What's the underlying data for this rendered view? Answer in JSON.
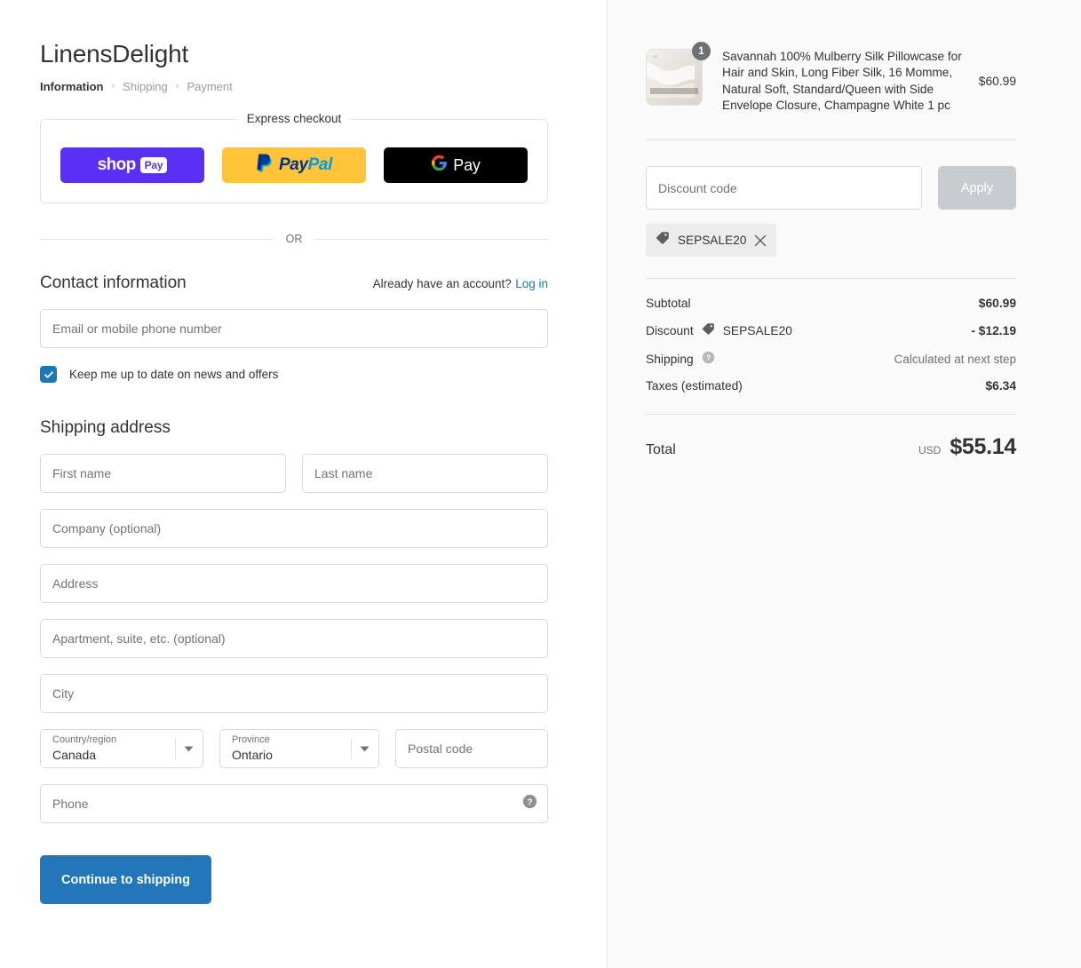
{
  "shop": {
    "name": "LinensDelight"
  },
  "breadcrumb": {
    "items": [
      {
        "label": "Information",
        "current": true
      },
      {
        "label": "Shipping",
        "current": false
      },
      {
        "label": "Payment",
        "current": false
      }
    ],
    "separator": "›"
  },
  "express": {
    "legend": "Express checkout",
    "buttons": [
      {
        "id": "shop-pay",
        "word": "shop",
        "badge": "Pay",
        "bg": "#5a31f4"
      },
      {
        "id": "paypal",
        "part1": "Pay",
        "part2": "Pal",
        "bg": "#ffc439"
      },
      {
        "id": "google-pay",
        "label": "Pay",
        "bg": "#000000"
      }
    ]
  },
  "divider": {
    "or": "OR"
  },
  "contact": {
    "title": "Contact information",
    "account_prompt": "Already have an account?",
    "login_link": "Log in",
    "email_placeholder": "Email or mobile phone number",
    "email_value": "",
    "newsletter_label": "Keep me up to date on news and offers",
    "newsletter_checked": true
  },
  "shipping_address": {
    "title": "Shipping address",
    "first_name_placeholder": "First name",
    "first_name_value": "",
    "last_name_placeholder": "Last name",
    "last_name_value": "",
    "company_placeholder": "Company (optional)",
    "company_value": "",
    "address_placeholder": "Address",
    "address_value": "",
    "apartment_placeholder": "Apartment, suite, etc. (optional)",
    "apartment_value": "",
    "city_placeholder": "City",
    "city_value": "",
    "country_label": "Country/region",
    "country_value": "Canada",
    "province_label": "Province",
    "province_value": "Ontario",
    "postal_placeholder": "Postal code",
    "postal_value": "",
    "phone_placeholder": "Phone",
    "phone_value": ""
  },
  "actions": {
    "continue_label": "Continue to shipping"
  },
  "order_summary": {
    "line_items": [
      {
        "title": "Savannah 100% Mulberry Silk Pillowcase for Hair and Skin, Long Fiber Silk, 16 Momme, Natural Soft, Standard/Queen with Side Envelope Closure, Champagne White 1 pc",
        "quantity": "1",
        "price": "$60.99"
      }
    ],
    "discount": {
      "placeholder": "Discount code",
      "value": "",
      "apply_label": "Apply",
      "applied_codes": [
        "SEPSALE20"
      ]
    },
    "totals": [
      {
        "label": "Subtotal",
        "value": "$60.99",
        "muted": false,
        "tag": "",
        "help": false
      },
      {
        "label": "Discount",
        "value": "- $12.19",
        "muted": false,
        "tag": "SEPSALE20",
        "help": false
      },
      {
        "label": "Shipping",
        "value": "Calculated at next step",
        "muted": true,
        "tag": "",
        "help": true
      },
      {
        "label": "Taxes (estimated)",
        "value": "$6.34",
        "muted": false,
        "tag": "",
        "help": false
      }
    ],
    "total": {
      "label": "Total",
      "currency": "USD",
      "amount": "$55.14"
    }
  },
  "colors": {
    "accent_blue": "#2277b8",
    "link_blue": "#1878b9",
    "checkbox_blue": "#1878b9",
    "shop_pay_purple": "#5a31f4",
    "paypal_yellow": "#ffc439",
    "paypal_navy": "#003087",
    "paypal_lightblue": "#009cde",
    "panel_bg": "#fafafa",
    "disabled_gray": "#c9cccf"
  }
}
